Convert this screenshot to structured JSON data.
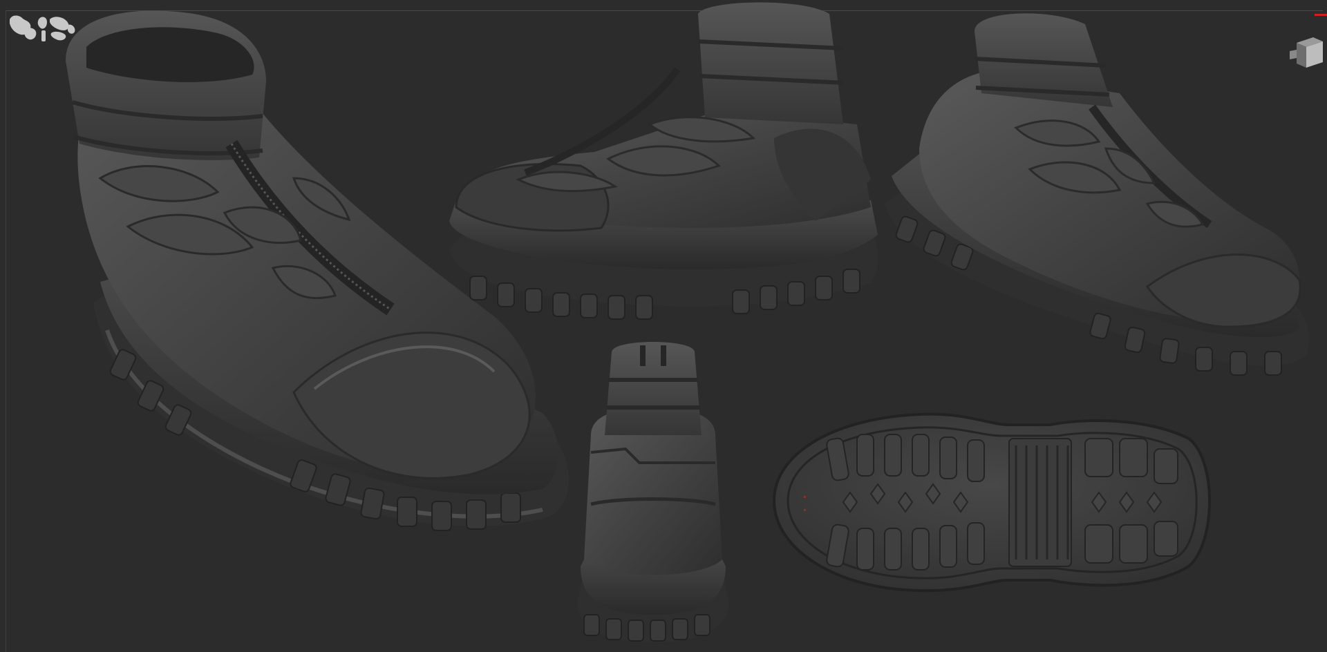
{
  "app": {
    "title": "",
    "viewport_label": ""
  },
  "colors": {
    "background": "#2c2c2c",
    "model_base": "#3a3a3a",
    "model_highlight": "#5a5a5a",
    "model_shadow": "#1f1f1f",
    "axis_accent": "#d02020",
    "logo": "#c8c8c8"
  },
  "icons": {
    "logo": "zbrush-logo-icon",
    "nav_cube": "navigation-cube-icon",
    "axis": "axis-indicator-icon"
  },
  "models": [
    {
      "name": "boot-hero-view"
    },
    {
      "name": "boot-side-view"
    },
    {
      "name": "boot-three-quarter-view"
    },
    {
      "name": "boot-rear-view"
    },
    {
      "name": "boot-sole-view"
    }
  ]
}
